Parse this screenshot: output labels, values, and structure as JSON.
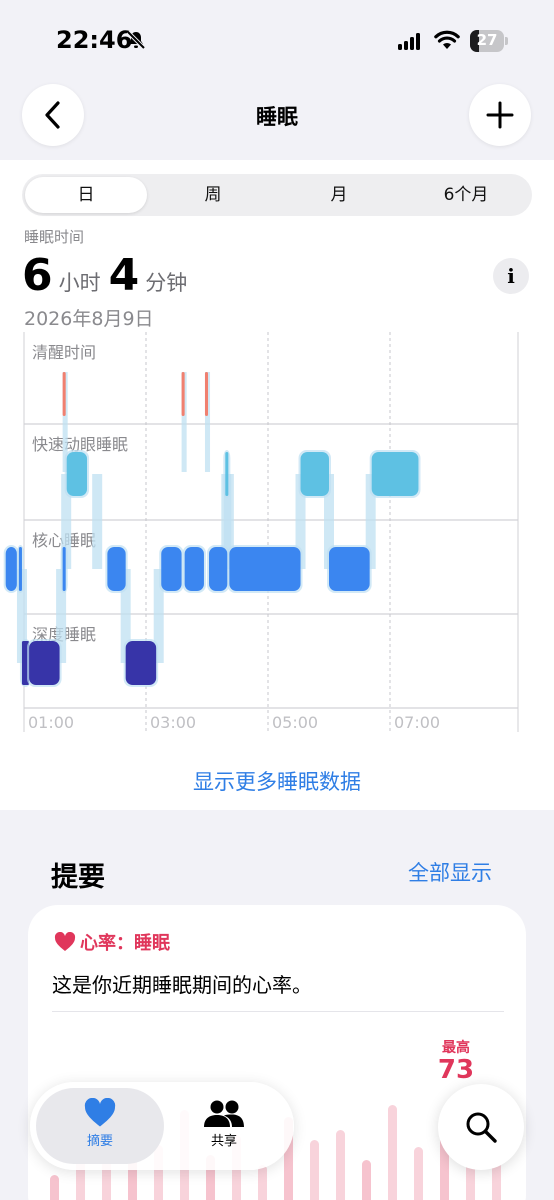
{
  "status": {
    "time": "22:46",
    "battery": "27",
    "battery_level": 0.27
  },
  "nav": {
    "title": "睡眠"
  },
  "segments": [
    {
      "label": "日",
      "active": true
    },
    {
      "label": "周",
      "active": false
    },
    {
      "label": "月",
      "active": false
    },
    {
      "label": "6个月",
      "active": false
    }
  ],
  "summary_head": {
    "label": "睡眠时间",
    "hours": "6",
    "hours_unit": "小时",
    "minutes": "4",
    "minutes_unit": "分钟",
    "date": "2026年8月9日"
  },
  "chart_data": {
    "type": "sleep-stages",
    "stages": [
      "清醒时间",
      "快速动眼睡眠",
      "核心睡眠",
      "深度睡眠"
    ],
    "x_ticks": [
      "01:00",
      "03:00",
      "05:00",
      "07:00"
    ],
    "colors": {
      "awake": "#f08070",
      "rem": "#5ec1e3",
      "core": "#3b86f0",
      "deep": "#3734a8",
      "connector": "#bfe0f2"
    },
    "segments": [
      {
        "stage": "核心睡眠",
        "start": "00:42",
        "end": "00:53"
      },
      {
        "stage": "核心睡眠",
        "start": "00:55",
        "end": "00:58"
      },
      {
        "stage": "深度睡眠",
        "start": "00:58",
        "end": "01:05"
      },
      {
        "stage": "深度睡眠",
        "start": "01:05",
        "end": "01:35"
      },
      {
        "stage": "核心睡眠",
        "start": "01:38",
        "end": "01:41"
      },
      {
        "stage": "清醒时间",
        "start": "01:38",
        "end": "01:41"
      },
      {
        "stage": "快速动眼睡眠",
        "start": "01:42",
        "end": "02:02"
      },
      {
        "stage": "核心睡眠",
        "start": "02:22",
        "end": "02:40"
      },
      {
        "stage": "深度睡眠",
        "start": "02:40",
        "end": "03:10"
      },
      {
        "stage": "核心睡眠",
        "start": "03:15",
        "end": "03:35"
      },
      {
        "stage": "清醒时间",
        "start": "03:35",
        "end": "03:38"
      },
      {
        "stage": "核心睡眠",
        "start": "03:38",
        "end": "03:57"
      },
      {
        "stage": "清醒时间",
        "start": "03:58",
        "end": "04:01"
      },
      {
        "stage": "核心睡眠",
        "start": "04:02",
        "end": "04:20"
      },
      {
        "stage": "快速动眼睡眠",
        "start": "04:18",
        "end": "04:21"
      },
      {
        "stage": "核心睡眠",
        "start": "04:22",
        "end": "05:32"
      },
      {
        "stage": "快速动眼睡眠",
        "start": "05:32",
        "end": "06:00"
      },
      {
        "stage": "核心睡眠",
        "start": "06:00",
        "end": "06:40"
      },
      {
        "stage": "快速动眼睡眠",
        "start": "06:42",
        "end": "07:28"
      }
    ]
  },
  "more_link": "显示更多睡眠数据",
  "summary": {
    "title": "提要",
    "show_all": "全部显示",
    "card": {
      "title": "心率：睡眠",
      "description": "这是你近期睡眠期间的心率。",
      "max_label": "最高",
      "max_value": "73"
    }
  },
  "tabs": [
    {
      "label": "摘要",
      "active": true
    },
    {
      "label": "共享",
      "active": false
    }
  ]
}
